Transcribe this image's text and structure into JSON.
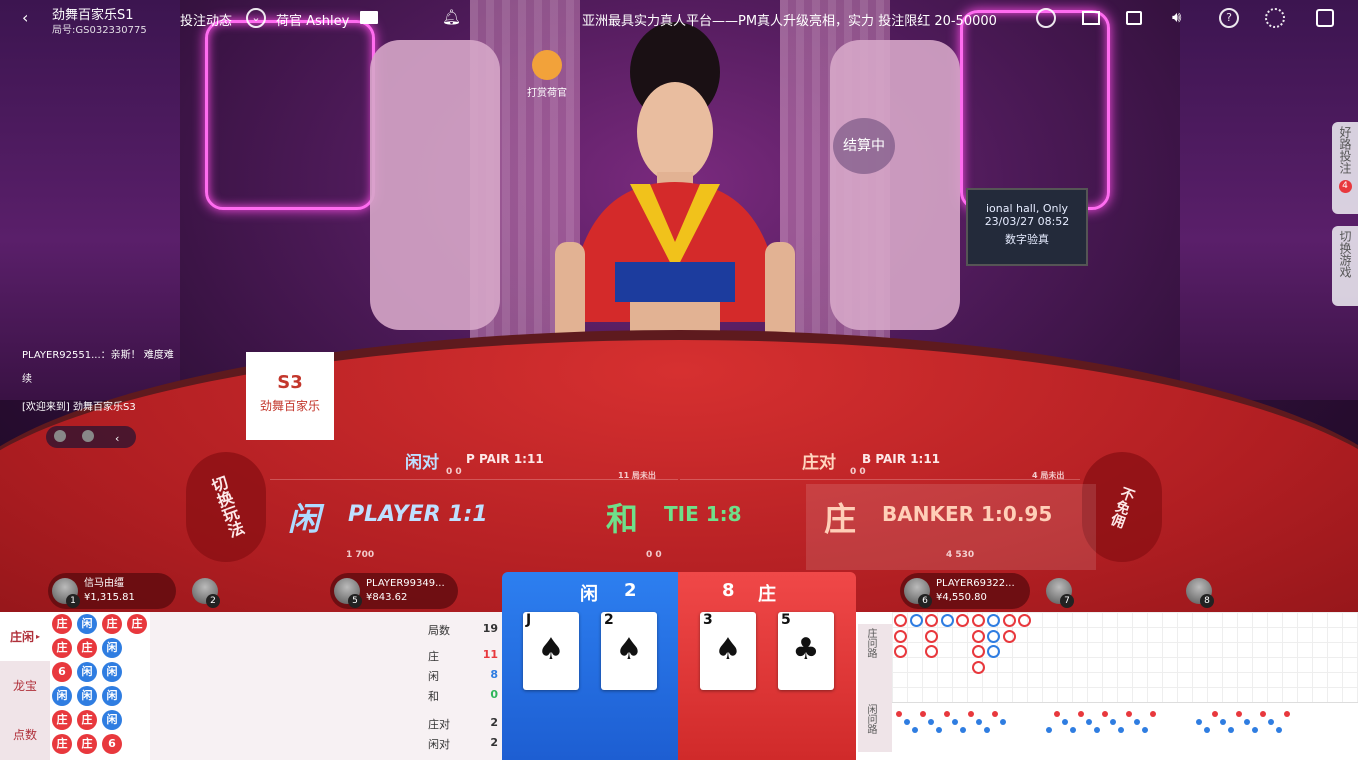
{
  "header": {
    "table_name": "劲舞百家乐S1",
    "game_id_label": "局号:",
    "game_id": "GS032330775",
    "bet_feed": "投注动态",
    "dealer_label": "荷官 Ashley",
    "marquee": "亚洲最具实力真人平台——PM真人升级亮相，实力 投注限红 20-50000"
  },
  "scene": {
    "tip_dealer": "打赏荷官",
    "settling": "结算中",
    "table_badge_code": "S3",
    "table_badge_name": "劲舞百家乐",
    "sign_line1": "ional hall, Only",
    "sign_date": "23/03/27",
    "sign_time": "08:52",
    "sign_verify": "数字验真"
  },
  "chat": {
    "line1": "PLAYER92551...：亲斯！ 难度难",
    "line1b": "续",
    "line2": "[欢迎来到] 劲舞百家乐S3"
  },
  "side_buttons": {
    "good_road": "好路投注",
    "good_road_count": "4",
    "switch_table": "切换游戏"
  },
  "bets": {
    "switch_play": "切换玩法",
    "no_commission": "不免佣",
    "player_pair": "闲对",
    "player_pair_en": "P PAIR 1:11",
    "player_pair_stats": "0  0",
    "banker_pair": "庄对",
    "banker_pair_en": "B PAIR 1:11",
    "banker_pair_stats": "0  0",
    "player_cn": "闲",
    "player_en": "PLAYER 1:1",
    "player_stats": "1   700",
    "tie_cn": "和",
    "tie_en": "TIE 1:8",
    "tie_stats": "0   0",
    "banker_cn": "庄",
    "banker_en": "BANKER 1:0.95",
    "banker_stats": "4   530",
    "player_unwin": "11 局未出",
    "banker_unwin": "4 局未出"
  },
  "seats": [
    {
      "num": "1",
      "name": "信马由缰",
      "amount": "¥1,315.81"
    },
    {
      "num": "2",
      "name": "",
      "amount": ""
    },
    {
      "num": "5",
      "name": "PLAYER99349...",
      "amount": "¥843.62"
    },
    {
      "num": "6",
      "name": "PLAYER69322...",
      "amount": "¥4,550.80"
    },
    {
      "num": "7",
      "name": "",
      "amount": ""
    },
    {
      "num": "8",
      "name": "",
      "amount": ""
    }
  ],
  "tabs": [
    "庄闲",
    "龙宝",
    "点数"
  ],
  "stats": {
    "rounds_label": "局数",
    "rounds": "19",
    "banker_label": "庄",
    "banker": "11",
    "player_label": "闲",
    "player": "8",
    "tie_label": "和",
    "tie": "0",
    "bpair_label": "庄对",
    "bpair": "2",
    "ppair_label": "闲对",
    "ppair": "2"
  },
  "result": {
    "player_label": "闲",
    "player_score": "2",
    "banker_label": "庄",
    "banker_score": "8",
    "player_cards": [
      {
        "rank": "J",
        "suit": "♠"
      },
      {
        "rank": "2",
        "suit": "♠"
      }
    ],
    "banker_cards": [
      {
        "rank": "3",
        "suit": "♠"
      },
      {
        "rank": "5",
        "suit": "♣"
      }
    ]
  },
  "ask_road": {
    "banker_ask": "庄问路",
    "player_ask": "闲问路"
  },
  "colors": {
    "banker": "#e8383d",
    "player": "#2f7de1",
    "tie": "#2fb55a"
  }
}
